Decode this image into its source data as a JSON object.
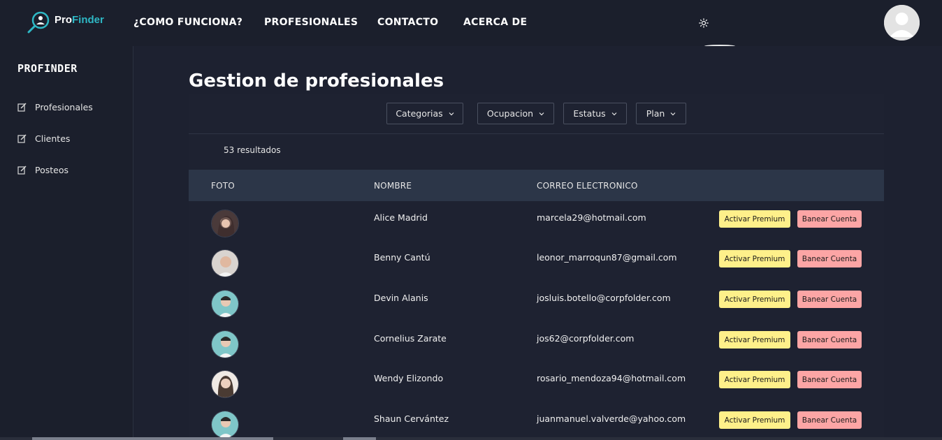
{
  "brand": {
    "pro": "Pro",
    "finder": "Finder"
  },
  "nav": {
    "items": [
      "¿COMO FUNCIONA?",
      "PROFESIONALES",
      "CONTACTO",
      "ACERCA DE"
    ]
  },
  "sidebar": {
    "title": "PROFINDER",
    "items": [
      {
        "label": "Profesionales",
        "icon": "edit-icon"
      },
      {
        "label": "Clientes",
        "icon": "edit-icon"
      },
      {
        "label": "Posteos",
        "icon": "edit-icon"
      }
    ]
  },
  "main": {
    "title": "Gestion de profesionales",
    "filters": [
      "Categorias",
      "Ocupacion",
      "Estatus",
      "Plan"
    ],
    "results": "53 resultados",
    "columns": [
      "FOTO",
      "NOMBRE",
      "CORREO ELECTRONICO"
    ],
    "premium_label": "Activar Premium",
    "ban_label": "Banear Cuenta",
    "rows": [
      {
        "name": "Alice Madrid",
        "email": "marcela29@hotmail.com",
        "avatar": "dark-hair-woman"
      },
      {
        "name": "Benny Cantú",
        "email": "leonor_marroqun87@gmail.com",
        "avatar": "older-man"
      },
      {
        "name": "Devin Alanis",
        "email": "josluis.botello@corpfolder.com",
        "avatar": "teal-person"
      },
      {
        "name": "Cornelius Zarate",
        "email": "jos62@corpfolder.com",
        "avatar": "teal-person"
      },
      {
        "name": "Wendy Elizondo",
        "email": "rosario_mendoza94@hotmail.com",
        "avatar": "woman-long-hair"
      },
      {
        "name": "Shaun Cervántez",
        "email": "juanmanuel.valverde@yahoo.com",
        "avatar": "teal-person"
      }
    ]
  },
  "colors": {
    "background": "#1d2130",
    "header_row": "#2c3648",
    "premium": "#fef08a",
    "ban": "#fca5a5",
    "brand_accent": "#2eb8c5"
  }
}
